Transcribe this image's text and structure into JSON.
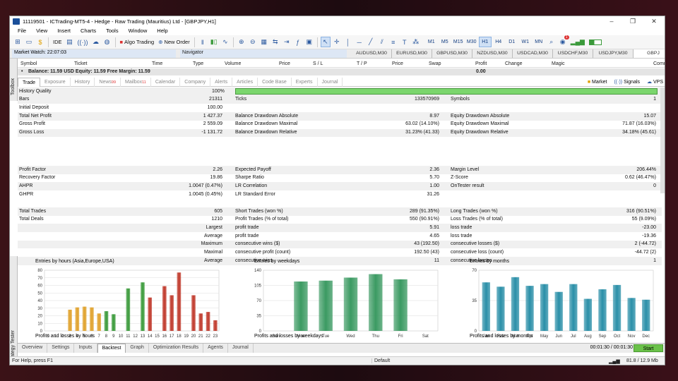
{
  "window": {
    "title": "11119501 - ICTrading-MT5-4 - Hedge - Raw Trading (Mauritius) Ltd - [GBPJPY,H1]"
  },
  "menu": [
    "File",
    "View",
    "Insert",
    "Charts",
    "Tools",
    "Window",
    "Help"
  ],
  "toolbar": {
    "ide": "IDE",
    "algo_trading": "Algo Trading",
    "new_order": "New Order",
    "timeframes": [
      "M1",
      "M5",
      "M15",
      "M30",
      "H1",
      "H4",
      "D1",
      "W1",
      "MN"
    ],
    "selected_timeframe": "H1",
    "notif_count": "1"
  },
  "panels": {
    "market_watch": "Market Watch: 22:07:03",
    "navigator": "Navigator",
    "chart_tabs": [
      "AUDUSD,M30",
      "EURUSD,M30",
      "GBPUSD,M30",
      "NZDUSD,M30",
      "USDCAD,M30",
      "USDCHF,M30",
      "USDJPY,M30",
      "GBPJ"
    ]
  },
  "toolbox": {
    "side_label": "Toolbox",
    "columns": [
      "Symbol",
      "Ticket",
      "Time",
      "Type",
      "Volume",
      "Price",
      "S / L",
      "T / P",
      "Price",
      "Swap",
      "Profit",
      "Change",
      "Magic",
      "Comment"
    ],
    "balance_line": "Balance: 11.59 USD  Equity: 11.59  Free Margin: 11.59",
    "balance_profit": "0.00",
    "tabs": [
      {
        "label": "Trade",
        "active": true
      },
      {
        "label": "Exposure"
      },
      {
        "label": "History"
      },
      {
        "label": "News",
        "badge": "99"
      },
      {
        "label": "Mailbox",
        "badge": "11"
      },
      {
        "label": "Calendar"
      },
      {
        "label": "Company"
      },
      {
        "label": "Alerts"
      },
      {
        "label": "Articles"
      },
      {
        "label": "Code Base"
      },
      {
        "label": "Experts"
      },
      {
        "label": "Journal"
      }
    ],
    "right": {
      "market": "Market",
      "signals": "Signals",
      "vps": "VPS"
    }
  },
  "report": {
    "history_quality_label": "History Quality",
    "history_quality": "100%",
    "rows1": [
      [
        "Bars",
        "21311",
        "Ticks",
        "133570969",
        "Symbols",
        "1"
      ],
      [
        "Initial Deposit",
        "100.00",
        "",
        "",
        "",
        ""
      ],
      [
        "Total Net Profit",
        "1 427.37",
        "Balance Drawdown Absolute",
        "8.97",
        "Equity Drawdown Absolute",
        "15.07"
      ],
      [
        "Gross Profit",
        "2 559.09",
        "Balance Drawdown Maximal",
        "63.02 (14.10%)",
        "Equity Drawdown Maximal",
        "71.87 (16.03%)"
      ],
      [
        "Gross Loss",
        "-1 131.72",
        "Balance Drawdown Relative",
        "31.23% (41.33)",
        "Equity Drawdown Relative",
        "34.18% (45.61)"
      ]
    ],
    "rows2": [
      [
        "Profit Factor",
        "2.26",
        "Expected Payoff",
        "2.36",
        "Margin Level",
        "206.44%"
      ],
      [
        "Recovery Factor",
        "19.86",
        "Sharpe Ratio",
        "5.70",
        "Z-Score",
        "0.62 (46.47%)"
      ],
      [
        "AHPR",
        "1.0047 (0.47%)",
        "LR Correlation",
        "1.00",
        "OnTester result",
        "0"
      ],
      [
        "GHPR",
        "1.0045 (0.45%)",
        "LR Standard Error",
        "31.26",
        "",
        ""
      ]
    ],
    "rows3": [
      [
        "Total Trades",
        "605",
        "Short Trades (won %)",
        "289 (91.35%)",
        "Long Trades (won %)",
        "316 (90.51%)"
      ],
      [
        "Total Deals",
        "1210",
        "Profit Trades (% of total)",
        "550 (90.91%)",
        "Loss Trades (% of total)",
        "55 (9.09%)"
      ],
      [
        "Largest",
        "",
        "profit trade",
        "5.91",
        "loss trade",
        "-23.00"
      ],
      [
        "Average",
        "",
        "profit trade",
        "4.65",
        "loss trade",
        "-19.36"
      ],
      [
        "Maximum",
        "",
        "consecutive wins ($)",
        "43 (192.50)",
        "consecutive losses ($)",
        "2 (-44.72)"
      ],
      [
        "Maximal",
        "",
        "consecutive profit (count)",
        "192.50 (43)",
        "consecutive loss (count)",
        "-44.72 (2)"
      ],
      [
        "Average",
        "",
        "consecutive wins",
        "11",
        "consecutive losses",
        "1"
      ]
    ]
  },
  "chart_data": [
    {
      "type": "bar",
      "title": "Entries by hours (Asia,Europe,USA)",
      "categories": [
        "0",
        "1",
        "2",
        "3",
        "4",
        "5",
        "6",
        "7",
        "8",
        "9",
        "10",
        "11",
        "12",
        "13",
        "14",
        "15",
        "16",
        "17",
        "18",
        "19",
        "20",
        "21",
        "22",
        "23"
      ],
      "values": [
        0,
        0,
        0,
        28,
        31,
        32,
        31,
        23,
        26,
        22,
        0,
        56,
        0,
        64,
        44,
        0,
        59,
        47,
        77,
        0,
        47,
        23,
        25,
        14
      ],
      "ylim": [
        0,
        80
      ],
      "yticks": [
        "80",
        "70",
        "60",
        "50",
        "40",
        "30",
        "20",
        "10",
        "0"
      ],
      "colors": [
        "#e0a12a",
        "#e0a12a",
        "#e0a12a",
        "#e0a12a",
        "#e0a12a",
        "#e0a12a",
        "#e0a12a",
        "#e0a12a",
        "#3a9a3a",
        "#3a9a3a",
        "#3a9a3a",
        "#3a9a3a",
        "#3a9a3a",
        "#3a9a3a",
        "#c0392b",
        "#c0392b",
        "#c0392b",
        "#c0392b",
        "#c0392b",
        "#c0392b",
        "#c0392b",
        "#c0392b",
        "#c0392b",
        "#c0392b"
      ],
      "subtitle": "Profits and losses by hours",
      "sub_tick": "230"
    },
    {
      "type": "bar",
      "title": "Entries by weekdays",
      "categories": [
        "Sun",
        "Mon",
        "Tue",
        "Wed",
        "Thu",
        "Fri",
        "Sat"
      ],
      "values": [
        0,
        114,
        116,
        123,
        131,
        119,
        0
      ],
      "ylim": [
        0,
        140
      ],
      "yticks": [
        "140",
        "105",
        "70",
        "35",
        "0"
      ],
      "color": "#3b9a62",
      "subtitle": "Profits and losses by weekdays",
      "sub_tick": "600"
    },
    {
      "type": "bar",
      "title": "Entries by months",
      "categories": [
        "Jan",
        "Feb",
        "Mar",
        "Apr",
        "May",
        "Jun",
        "Jul",
        "Aug",
        "Sep",
        "Oct",
        "Nov",
        "Dec"
      ],
      "values": [
        56,
        51,
        62,
        52,
        54,
        45,
        54,
        37,
        48,
        53,
        38,
        36
      ],
      "ylim": [
        0,
        70
      ],
      "yticks": [
        "70",
        "35",
        "0"
      ],
      "color": "#2a8fa8",
      "subtitle": "Profits and losses by months",
      "sub_tick": "270"
    }
  ],
  "strategy": {
    "side_label": "Strategy Tester",
    "tabs": [
      {
        "label": "Overview"
      },
      {
        "label": "Settings"
      },
      {
        "label": "Inputs"
      },
      {
        "label": "Backtest",
        "active": true
      },
      {
        "label": "Graph"
      },
      {
        "label": "Optimization Results"
      },
      {
        "label": "Agents"
      },
      {
        "label": "Journal"
      }
    ],
    "timer": "00:01:30 / 00:01:30",
    "start": "Start"
  },
  "statusbar": {
    "help": "For Help, press F1",
    "profile": "Default",
    "net": "81.8 / 12.9 Mb"
  }
}
